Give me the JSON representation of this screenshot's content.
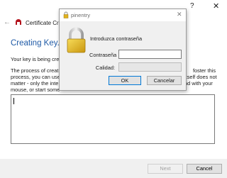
{
  "window": {
    "help_label": "?",
    "close_label": "✕",
    "back_label": "←",
    "app_title": "Certificate Cr"
  },
  "wizard": {
    "page_title": "Creating Key...",
    "line1": "Your key is being crea",
    "para_lines": [
      "The process of creat",
      "process, you can use",
      "matter - only the inte",
      "mouse, or start some"
    ],
    "para_right_lines": [
      "foster this",
      "itself does not",
      "nd with your"
    ],
    "entropy_value": ""
  },
  "footer": {
    "next_label": "Next",
    "cancel_label": "Cancel"
  },
  "pinentry": {
    "title": "pinentry",
    "close_label": "✕",
    "prompt": "Introduzca contraseña",
    "password_label": "Contraseña",
    "quality_label": "Calidad:",
    "ok_label": "OK",
    "cancel_label": "Cancelar",
    "password_value": ""
  },
  "colors": {
    "accent": "#1f5aa6",
    "dialog_bg": "#f0f0f0",
    "default_button_border": "#0078d7",
    "lock_gold": "#e0b21e"
  }
}
